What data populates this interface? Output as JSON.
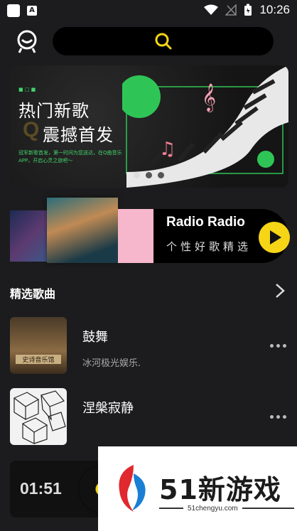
{
  "status_bar": {
    "time": "10:26",
    "left_icons": [
      "square-icon",
      "a-icon"
    ],
    "right_icons": [
      "wifi-icon",
      "signal-icon",
      "battery-icon"
    ]
  },
  "header": {
    "avatar_icon": "smiley-icon",
    "search_icon": "search-icon"
  },
  "banner": {
    "tag": "■ □ ■",
    "title_line1": "热门新歌",
    "q_mark": "Q",
    "title_line2": "震撼首发",
    "description": "冠军新歌首发，第一时间为您送达，在Q曲音乐APP，开启心灵之旅吧～",
    "carousel_dots": 3,
    "active_dot": 0
  },
  "radio": {
    "title": "Radio Radio",
    "subtitle": "个性好歌精选"
  },
  "section": {
    "title": "精选歌曲"
  },
  "songs": [
    {
      "title": "鼓舞",
      "artist": "冰河极光娱乐.",
      "cover_label": "史诗音乐馆"
    },
    {
      "title": "涅槃寂静",
      "artist": ""
    }
  ],
  "player": {
    "time": "01:51"
  },
  "watermark": {
    "title": "51新游戏",
    "url": "51chengyu.com"
  },
  "colors": {
    "accent": "#f5d516",
    "banner_green": "#43d36b",
    "background": "#1c1c1e"
  }
}
